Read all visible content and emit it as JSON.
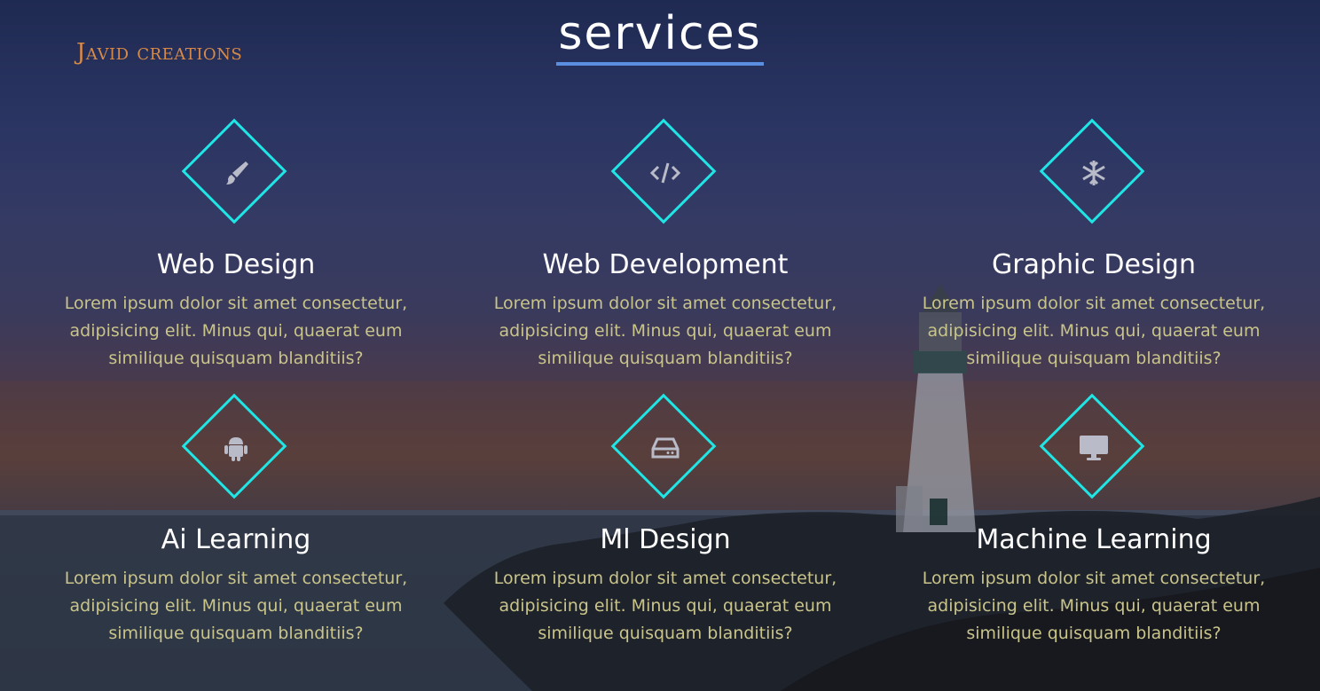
{
  "brand": "Javid creations",
  "page_title": "services",
  "colors": {
    "accent": "#1fe5e5",
    "title_underline": "#5b8de0",
    "brand": "#d68a4a",
    "description": "#c9c48a"
  },
  "services": [
    {
      "icon": "paint-brush-icon",
      "title": "Web Design",
      "description": "Lorem ipsum dolor sit amet consectetur, adipisicing elit. Minus qui, quaerat eum similique quisquam blanditiis?"
    },
    {
      "icon": "code-icon",
      "title": "Web Development",
      "description": "Lorem ipsum dolor sit amet consectetur, adipisicing elit. Minus qui, quaerat eum similique quisquam blanditiis?"
    },
    {
      "icon": "snowflake-icon",
      "title": "Graphic Design",
      "description": "Lorem ipsum dolor sit amet consectetur, adipisicing elit. Minus qui, quaerat eum similique quisquam blanditiis?"
    },
    {
      "icon": "android-icon",
      "title": "Ai Learning",
      "description": "Lorem ipsum dolor sit amet consectetur, adipisicing elit. Minus qui, quaerat eum similique quisquam blanditiis?"
    },
    {
      "icon": "hard-drive-icon",
      "title": "Ml Design",
      "description": "Lorem ipsum dolor sit amet consectetur, adipisicing elit. Minus qui, quaerat eum similique quisquam blanditiis?"
    },
    {
      "icon": "desktop-icon",
      "title": "Machine Learning",
      "description": "Lorem ipsum dolor sit amet consectetur, adipisicing elit. Minus qui, quaerat eum similique quisquam blanditiis?"
    }
  ]
}
